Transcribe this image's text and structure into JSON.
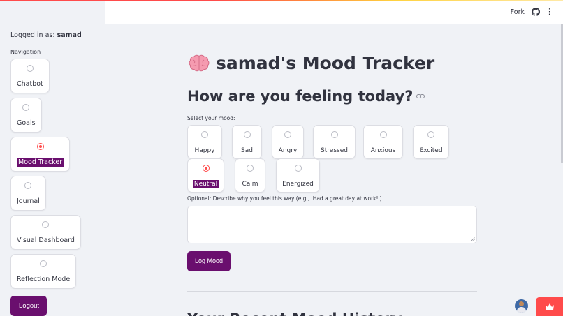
{
  "sidebar": {
    "logged_in_prefix": "Logged in as:",
    "username": "samad",
    "nav_label": "Navigation",
    "items": [
      {
        "label": "Chatbot",
        "selected": false
      },
      {
        "label": "Goals",
        "selected": false
      },
      {
        "label": "Mood Tracker",
        "selected": true
      },
      {
        "label": "Journal",
        "selected": false
      },
      {
        "label": "Visual Dashboard",
        "selected": false
      },
      {
        "label": "Reflection Mode",
        "selected": false
      }
    ],
    "logout_label": "Logout"
  },
  "header": {
    "fork_label": "Fork",
    "icons": [
      "github-icon",
      "kebab-menu-icon"
    ]
  },
  "main": {
    "title": "samad's Mood Tracker",
    "title_icon": "brain-emoji",
    "subtitle": "How are you feeling today?",
    "select_label": "Select your mood:",
    "moods": [
      {
        "label": "Happy",
        "selected": false
      },
      {
        "label": "Sad",
        "selected": false
      },
      {
        "label": "Angry",
        "selected": false
      },
      {
        "label": "Stressed",
        "selected": false
      },
      {
        "label": "Anxious",
        "selected": false
      },
      {
        "label": "Excited",
        "selected": false
      },
      {
        "label": "Neutral",
        "selected": true
      },
      {
        "label": "Calm",
        "selected": false
      },
      {
        "label": "Energized",
        "selected": false
      }
    ],
    "optional_label": "Optional: Describe why you feel this way (e.g., 'Had a great day at work!')",
    "textarea_value": "",
    "log_button_label": "Log Mood",
    "history_heading": "Your Recent Mood History"
  },
  "colors": {
    "accent": "#6a0f6e",
    "radio_selected": "#ff4b4b",
    "sidebar_bg": "#f0f2f6",
    "text": "#31333f"
  }
}
